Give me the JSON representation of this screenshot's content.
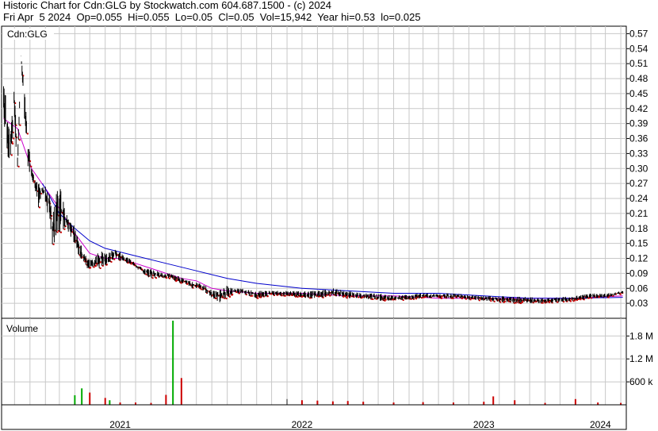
{
  "header": {
    "line1": "Historic Chart for Cdn:GLG by Stockwatch.com 604.687.1500 - (c) 2024",
    "line2": "Fri Apr  5 2024  Op=0.055  Hi=0.055  Lo=0.05  Cl=0.05  Vol=15,942  Year hi=0.53  lo=0.025"
  },
  "chart_data": [
    {
      "type": "line",
      "title": "Cdn:GLG",
      "subtype": "daily high-low price bars with moving averages",
      "y_axis_position": "right",
      "ylim": [
        0.0,
        0.585
      ],
      "y_ticks": [
        0.03,
        0.06,
        0.09,
        0.12,
        0.15,
        0.18,
        0.21,
        0.24,
        0.27,
        0.3,
        0.33,
        0.36,
        0.39,
        0.42,
        0.45,
        0.48,
        0.51,
        0.54,
        0.57
      ],
      "y_tick_labels": [
        "0.03",
        "0.06",
        "0.09",
        "0.12",
        "0.15",
        "0.18",
        "0.21",
        "0.24",
        "0.27",
        "0.30",
        "0.33",
        "0.36",
        "0.39",
        "0.42",
        "0.45",
        "0.48",
        "0.51",
        "0.54",
        "0.57"
      ],
      "x_labels": [
        "2021",
        "2022",
        "2023",
        "2024"
      ],
      "grid": true,
      "colors": {
        "price": "#000000",
        "down_close": "#cc0000",
        "ma_short": "#cc00cc",
        "ma_long": "#0000cc",
        "grid": "#c8c8c8"
      },
      "price_path": {
        "x": [
          "2020-11-09",
          "2020-11-16",
          "2020-11-23",
          "2020-11-30",
          "2020-12-07",
          "2020-12-14",
          "2020-12-21",
          "2020-12-28",
          "2021-01-04",
          "2021-01-11",
          "2021-01-18",
          "2021-01-25",
          "2021-02-08",
          "2021-02-15",
          "2021-03-01",
          "2021-03-15",
          "2021-03-29",
          "2021-04-12",
          "2021-04-26",
          "2021-05-10",
          "2021-05-24",
          "2021-06-07",
          "2021-06-21",
          "2021-07-05",
          "2021-07-19",
          "2021-08-02",
          "2021-08-16",
          "2021-08-30",
          "2021-09-13",
          "2021-09-27",
          "2021-10-11",
          "2021-10-25",
          "2021-11-08",
          "2021-11-22",
          "2021-12-06",
          "2021-12-20",
          "2022-01-03",
          "2022-01-17",
          "2022-01-31",
          "2022-02-14",
          "2022-03-01",
          "2022-04-01",
          "2022-05-01",
          "2022-06-01",
          "2022-07-01",
          "2022-08-01",
          "2022-09-01",
          "2022-10-01",
          "2022-11-01",
          "2022-12-01",
          "2023-01-01",
          "2023-03-01",
          "2023-05-01",
          "2023-07-01",
          "2023-09-01",
          "2023-11-01",
          "2024-01-01",
          "2024-02-01",
          "2024-03-01",
          "2024-04-05"
        ],
        "low": [
          0.4,
          0.33,
          0.3,
          0.4,
          0.28,
          0.52,
          0.4,
          0.3,
          0.28,
          0.26,
          0.22,
          0.25,
          0.2,
          0.14,
          0.17,
          0.18,
          0.15,
          0.12,
          0.1,
          0.1,
          0.1,
          0.11,
          0.12,
          0.11,
          0.11,
          0.1,
          0.09,
          0.08,
          0.08,
          0.08,
          0.08,
          0.07,
          0.07,
          0.06,
          0.06,
          0.05,
          0.04,
          0.03,
          0.04,
          0.05,
          0.05,
          0.04,
          0.045,
          0.045,
          0.04,
          0.04,
          0.045,
          0.04,
          0.04,
          0.035,
          0.035,
          0.04,
          0.04,
          0.035,
          0.03,
          0.03,
          0.035,
          0.04,
          0.04,
          0.05
        ],
        "high": [
          0.49,
          0.42,
          0.38,
          0.47,
          0.33,
          0.53,
          0.46,
          0.36,
          0.3,
          0.28,
          0.27,
          0.27,
          0.26,
          0.21,
          0.28,
          0.21,
          0.19,
          0.15,
          0.12,
          0.12,
          0.14,
          0.13,
          0.14,
          0.13,
          0.12,
          0.11,
          0.1,
          0.1,
          0.095,
          0.09,
          0.09,
          0.085,
          0.08,
          0.075,
          0.07,
          0.065,
          0.055,
          0.06,
          0.065,
          0.06,
          0.06,
          0.055,
          0.055,
          0.055,
          0.055,
          0.055,
          0.06,
          0.055,
          0.05,
          0.05,
          0.045,
          0.05,
          0.05,
          0.045,
          0.045,
          0.04,
          0.045,
          0.05,
          0.05,
          0.055
        ]
      },
      "series": [
        {
          "x": [
            "2020-11-09",
            "2020-12-07",
            "2021-01-04",
            "2021-02-01",
            "2021-03-01",
            "2021-04-01",
            "2021-05-01",
            "2021-06-01",
            "2021-07-01",
            "2021-08-01",
            "2021-09-01",
            "2021-10-01",
            "2021-11-01",
            "2021-12-01",
            "2022-01-01",
            "2022-02-01",
            "2022-04-01",
            "2022-07-01",
            "2022-10-01",
            "2023-01-01",
            "2023-04-01",
            "2023-07-01",
            "2023-10-01",
            "2024-01-01",
            "2024-04-05"
          ],
          "values": [
            0.4,
            0.38,
            0.3,
            0.26,
            0.22,
            0.17,
            0.13,
            0.12,
            0.12,
            0.11,
            0.1,
            0.09,
            0.08,
            0.075,
            0.06,
            0.055,
            0.05,
            0.05,
            0.045,
            0.045,
            0.04,
            0.04,
            0.04,
            0.04,
            0.045
          ]
        },
        {
          "x": [
            "2021-01-26",
            "2021-03-01",
            "2021-04-01",
            "2021-05-01",
            "2021-06-01",
            "2021-08-01",
            "2021-10-01",
            "2021-12-01",
            "2022-02-01",
            "2022-04-01",
            "2022-07-01",
            "2022-10-01",
            "2023-01-01",
            "2023-04-01",
            "2023-07-01",
            "2023-10-01",
            "2024-01-01",
            "2024-04-05"
          ],
          "values": [
            0.27,
            0.21,
            0.18,
            0.155,
            0.14,
            0.125,
            0.11,
            0.095,
            0.08,
            0.07,
            0.06,
            0.055,
            0.05,
            0.05,
            0.045,
            0.04,
            0.04,
            0.042
          ]
        }
      ]
    },
    {
      "type": "bar",
      "title": "Volume",
      "y_axis_position": "right",
      "ylim": [
        0,
        2200000
      ],
      "y_ticks": [
        600000,
        1200000,
        1800000
      ],
      "y_tick_labels": [
        "600 k",
        "1.2 M",
        "1.8 M"
      ],
      "colors": {
        "up": "#00aa00",
        "down": "#cc0000",
        "unchanged": "#888888"
      },
      "x": [
        "2021-04-01",
        "2021-04-15",
        "2021-05-01",
        "2021-06-01",
        "2021-06-10",
        "2021-07-01",
        "2021-08-01",
        "2021-09-01",
        "2021-10-01",
        "2021-10-15",
        "2021-11-01",
        "2022-06-01",
        "2022-07-01",
        "2022-08-01",
        "2022-09-01",
        "2022-10-01",
        "2022-11-01",
        "2023-01-01",
        "2023-03-01",
        "2023-05-01",
        "2023-07-01",
        "2023-07-20",
        "2023-09-01",
        "2023-11-01",
        "2024-01-01",
        "2024-02-15",
        "2024-04-01"
      ],
      "values": [
        250000,
        430000,
        320000,
        180000,
        120000,
        60000,
        60000,
        50000,
        260000,
        2200000,
        700000,
        150000,
        120000,
        110000,
        90000,
        100000,
        80000,
        60000,
        70000,
        60000,
        80000,
        220000,
        120000,
        50000,
        150000,
        60000,
        50000
      ],
      "direction": [
        "up",
        "up",
        "down",
        "down",
        "up",
        "down",
        "down",
        "down",
        "down",
        "up",
        "down",
        "unchanged",
        "down",
        "down",
        "down",
        "down",
        "down",
        "down",
        "down",
        "down",
        "down",
        "down",
        "down",
        "down",
        "down",
        "down",
        "down"
      ]
    }
  ]
}
